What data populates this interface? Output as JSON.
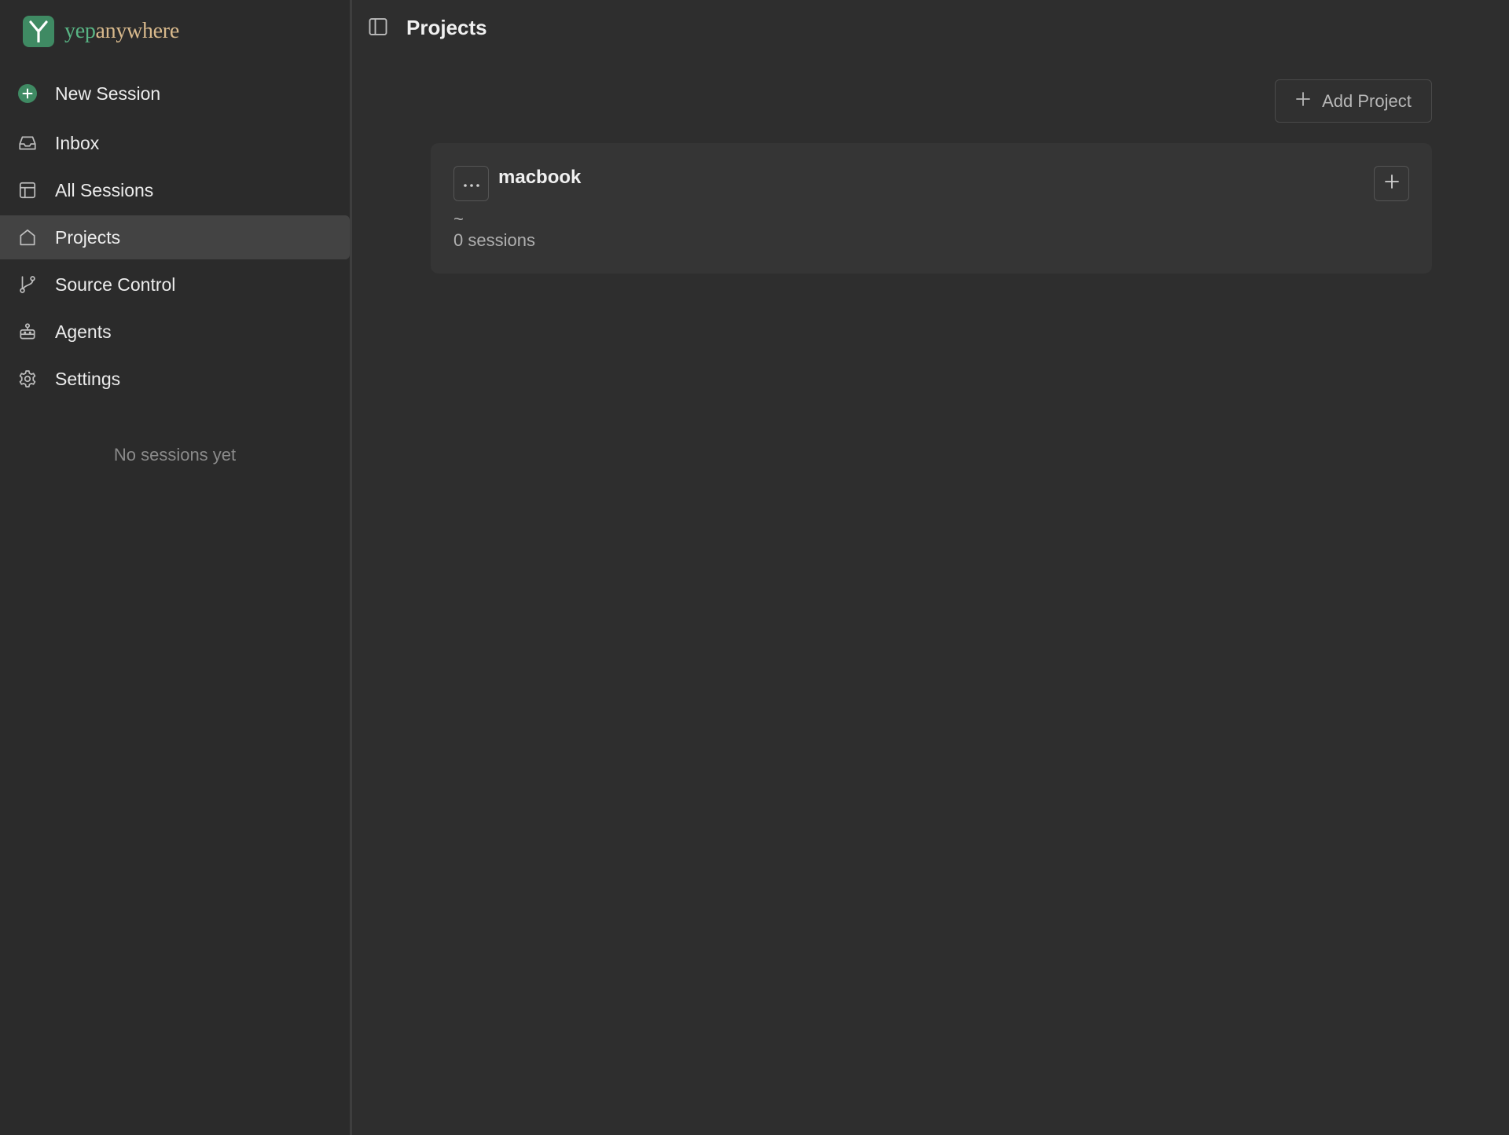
{
  "brand": {
    "name_part1": "yep",
    "name_part2": "anywhere"
  },
  "sidebar": {
    "items": [
      {
        "id": "new-session",
        "label": "New Session",
        "icon": "plus-circle-icon"
      },
      {
        "id": "inbox",
        "label": "Inbox",
        "icon": "inbox-icon"
      },
      {
        "id": "all-sessions",
        "label": "All Sessions",
        "icon": "layout-icon"
      },
      {
        "id": "projects",
        "label": "Projects",
        "icon": "home-icon",
        "active": true
      },
      {
        "id": "source-control",
        "label": "Source Control",
        "icon": "git-branch-icon"
      },
      {
        "id": "agents",
        "label": "Agents",
        "icon": "robot-icon"
      },
      {
        "id": "settings",
        "label": "Settings",
        "icon": "gear-icon"
      }
    ],
    "empty_message": "No sessions yet"
  },
  "header": {
    "title": "Projects"
  },
  "toolbar": {
    "add_project_label": "Add Project"
  },
  "projects": [
    {
      "name": "macbook",
      "path": "~",
      "sessions": "0 sessions"
    }
  ],
  "colors": {
    "accent_green": "#3f8a63",
    "brand_yep": "#58b484",
    "brand_anywhere": "#d8b98c",
    "background": "#2e2e2e",
    "active_item": "#434343"
  }
}
